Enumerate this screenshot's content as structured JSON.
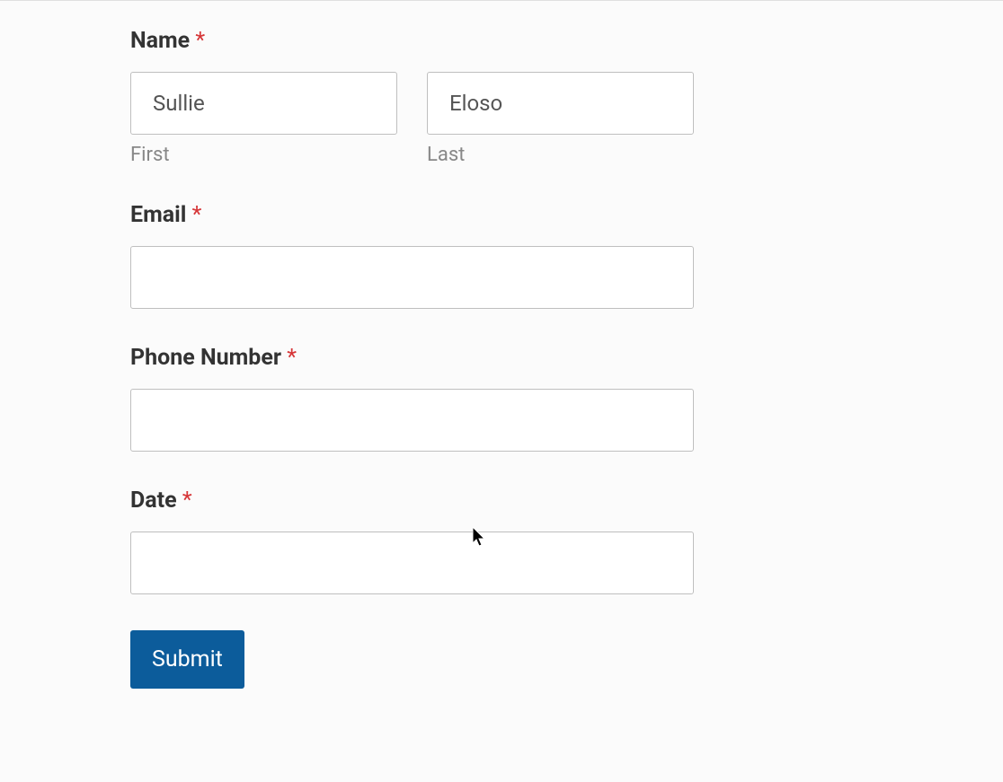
{
  "form": {
    "name": {
      "label": "Name",
      "first": {
        "value": "Sullie",
        "sublabel": "First"
      },
      "last": {
        "value": "Eloso",
        "sublabel": "Last"
      }
    },
    "email": {
      "label": "Email",
      "value": ""
    },
    "phone": {
      "label": "Phone Number",
      "value": ""
    },
    "date": {
      "label": "Date",
      "value": ""
    },
    "submit_label": "Submit",
    "required_marker": "*"
  }
}
